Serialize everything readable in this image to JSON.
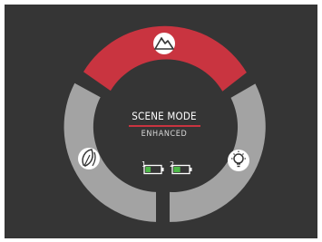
{
  "scene_mode": {
    "title": "SCENE MODE",
    "subtitle": "ENHANCED"
  },
  "segments": [
    {
      "id": "top",
      "icon": "mountain-icon",
      "selected": true
    },
    {
      "id": "left",
      "icon": "leaf-icon",
      "selected": false
    },
    {
      "id": "right",
      "icon": "light-bulb-icon",
      "selected": false
    }
  ],
  "batteries": [
    {
      "label": "1",
      "level": 0.35
    },
    {
      "label": "2",
      "level": 0.45
    }
  ],
  "colors": {
    "background": "#353535",
    "selected": "#c93440",
    "unselected": "#a3a3a3",
    "battery_fill": "#4db848",
    "accent_line": "#c93440"
  }
}
